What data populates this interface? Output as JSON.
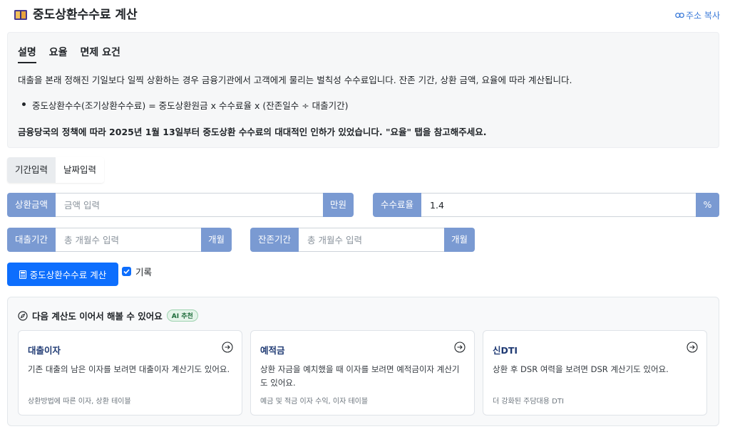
{
  "header": {
    "title": "중도상환수수료 계산",
    "copy_link": "주소 복사"
  },
  "info": {
    "tabs": [
      {
        "label": "설명",
        "active": true
      },
      {
        "label": "요율",
        "active": false
      },
      {
        "label": "면제 요건",
        "active": false
      }
    ],
    "description": "대출을 본래 정해진 기일보다 일찍 상환하는 경우 금융기관에서 고객에게 물리는 벌칙성 수수료입니다. 잔존 기간, 상환 금액, 요율에 따라 계산됩니다.",
    "formula": "중도상환수수(조기상환수수료) = 중도상환원금 x 수수료율 x (잔존일수 ÷ 대출기간)",
    "notice": "금융당국의 정책에 따라 2025년 1월 13일부터 중도상환 수수료의 대대적인 인하가 있었습니다. \"요율\" 탭을 참고해주세요."
  },
  "mode": {
    "period_label": "기간입력",
    "date_label": "날짜입력",
    "selected": "기간입력"
  },
  "form": {
    "repayment": {
      "label": "상환금액",
      "placeholder": "금액 입력",
      "value": "",
      "unit": "만원"
    },
    "rate": {
      "label": "수수료율",
      "placeholder": "",
      "value": "1.4",
      "unit": "%"
    },
    "loan_period": {
      "label": "대출기간",
      "placeholder": "총 개월수 입력",
      "value": "",
      "unit": "개월"
    },
    "remaining_period": {
      "label": "잔존기간",
      "placeholder": "총 개월수 입력",
      "value": "",
      "unit": "개월"
    },
    "calc_button": "중도상환수수료 계산",
    "record_label": "기록",
    "record_checked": true
  },
  "recommend": {
    "heading": "다음 계산도 이어서 해볼 수 있어요",
    "badge": "AI 추천",
    "cards": [
      {
        "title": "대출이자",
        "desc": "기존 대출의 남은 이자를 보려면 대출이자 계산기도 있어요.",
        "foot": "상환방법에 따른 이자, 상환 테이블"
      },
      {
        "title": "예적금",
        "desc": "상환 자금을 예치했을 때 이자를 보려면 예적금이자 계산기도 있어요.",
        "foot": "예금 및 적금 이자 수익, 이자 테이블"
      },
      {
        "title": "신DTI",
        "desc": "상환 후 DSR 여력을 보려면 DSR 계산기도 있어요.",
        "foot": "더 강화된 주담대용 DTI"
      }
    ]
  },
  "colors": {
    "primary": "#0d6efd",
    "label_bg": "#7a9ad2",
    "card_title": "#1f3a73"
  }
}
